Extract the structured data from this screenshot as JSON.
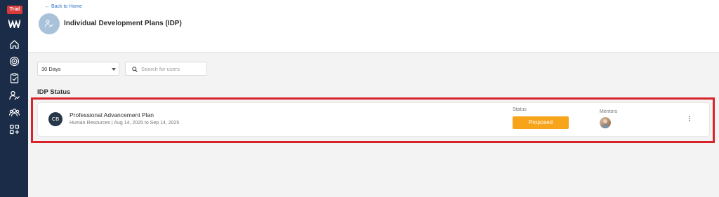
{
  "sidebar": {
    "trial_badge": "Trial",
    "logo": "w-logo",
    "items": [
      {
        "icon": "home-icon"
      },
      {
        "icon": "target-icon"
      },
      {
        "icon": "clipboard-check-icon"
      },
      {
        "icon": "user-growth-icon"
      },
      {
        "icon": "team-icon"
      },
      {
        "icon": "apps-add-icon"
      }
    ],
    "background": "#1b2c48"
  },
  "header": {
    "back_link": "← Back to Home",
    "title": "Individual Development Plans (IDP)",
    "icon": "user-growth-icon"
  },
  "filters": {
    "period_value": "30 Days",
    "search_placeholder": "Search for users"
  },
  "section": {
    "title": "IDP Status"
  },
  "idp_card": {
    "initials": "CB",
    "plan_name": "Professional Advancement Plan",
    "meta": "Human Resources | Aug 14, 2025 to Sep 14, 2025",
    "status_label": "Status",
    "status_value": "Proposed",
    "mentors_label": "Mentors"
  },
  "colors": {
    "accent": "#2f74c0",
    "status_proposed": "#f8a41a",
    "highlight": "#d6242a",
    "trial": "#d93a3a"
  }
}
